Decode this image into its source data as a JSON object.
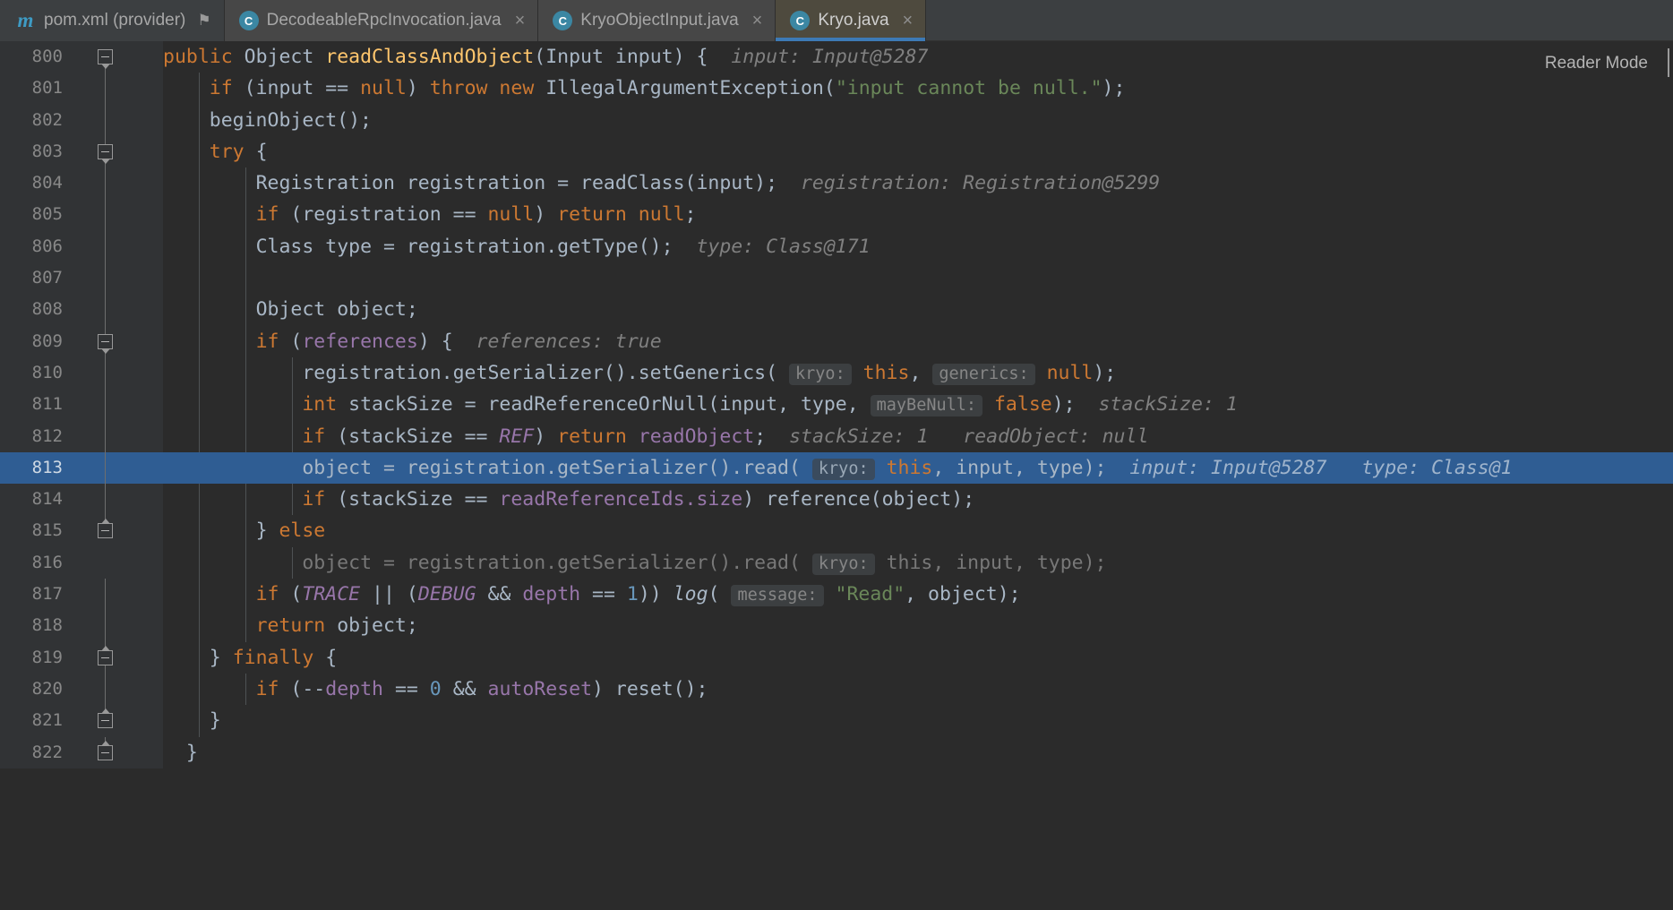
{
  "tabs": [
    {
      "label": "pom.xml (provider)",
      "icon": "maven-icon",
      "icon_text": "m",
      "state": "pinned",
      "pin": "⚑",
      "close": ""
    },
    {
      "label": "DecodeableRpcInvocation.java",
      "icon": "java-class-icon",
      "icon_text": "C",
      "state": "inactive",
      "close": "×"
    },
    {
      "label": "KryoObjectInput.java",
      "icon": "java-class-icon",
      "icon_text": "C",
      "state": "inactive",
      "close": "×"
    },
    {
      "label": "Kryo.java",
      "icon": "java-class-icon",
      "icon_text": "C",
      "state": "active",
      "close": "×"
    }
  ],
  "editor": {
    "reader_mode_label": "Reader Mode",
    "highlighted_line": 813,
    "first_line": 800,
    "last_line": 822,
    "colors": {
      "background": "#2b2b2b",
      "gutter_background": "#313335",
      "line_highlight": "#2f5d93",
      "keyword": "#cc7832",
      "method": "#ffc66d",
      "field": "#9876aa",
      "string": "#6a8759",
      "number": "#6897bb",
      "plain": "#a9b7c6",
      "inline_hint": "#808080",
      "tab_active": "#4e4a3e",
      "tab_underline": "#3d7ab5"
    },
    "lines": [
      {
        "n": "800",
        "text": "    public Object readClassAndObject(Input input) {  input: Input@5287"
      },
      {
        "n": "801",
        "text": "        if (input == null) throw new IllegalArgumentException(\"input cannot be null.\");"
      },
      {
        "n": "802",
        "text": "        beginObject();"
      },
      {
        "n": "803",
        "text": "        try {"
      },
      {
        "n": "804",
        "text": "            Registration registration = readClass(input);  registration: Registration@5299"
      },
      {
        "n": "805",
        "text": "            if (registration == null) return null;"
      },
      {
        "n": "806",
        "text": "            Class type = registration.getType();  type: Class@171"
      },
      {
        "n": "807",
        "text": ""
      },
      {
        "n": "808",
        "text": "            Object object;"
      },
      {
        "n": "809",
        "text": "            if (references) {  references: true"
      },
      {
        "n": "810",
        "text": "                registration.getSerializer().setGenerics( kryo: this,  generics: null);"
      },
      {
        "n": "811",
        "text": "                int stackSize = readReferenceOrNull(input, type,  mayBeNull: false);  stackSize: 1"
      },
      {
        "n": "812",
        "text": "                if (stackSize == REF) return readObject;  stackSize: 1    readObject: null"
      },
      {
        "n": "813",
        "text": "                object = registration.getSerializer().read( kryo: this, input, type);  input: Input@5287    type: Class@1"
      },
      {
        "n": "814",
        "text": "                if (stackSize == readReferenceIds.size) reference(object);"
      },
      {
        "n": "815",
        "text": "            } else"
      },
      {
        "n": "816",
        "text": "                object = registration.getSerializer().read( kryo: this, input, type);"
      },
      {
        "n": "817",
        "text": "            if (TRACE || (DEBUG && depth == 1)) log( message: \"Read\", object);"
      },
      {
        "n": "818",
        "text": "            return object;"
      },
      {
        "n": "819",
        "text": "        } finally {"
      },
      {
        "n": "820",
        "text": "            if (--depth == 0 && autoReset) reset();"
      },
      {
        "n": "821",
        "text": "        }"
      },
      {
        "n": "822",
        "text": "    }"
      }
    ],
    "inline_hints": {
      "line_800": "input: Input@5287",
      "line_804": "registration: Registration@5299",
      "line_806": "type: Class@171",
      "line_809": "references: true",
      "line_811": "stackSize: 1",
      "line_812_a": "stackSize: 1",
      "line_812_b": "readObject: null",
      "line_813_a": "input: Input@5287",
      "line_813_b": "type: Class@1"
    },
    "param_hints": {
      "line_810_a": "kryo:",
      "line_810_b": "generics:",
      "line_811": "mayBeNull:",
      "line_813": "kryo:",
      "line_816": "kryo:",
      "line_817": "message:"
    }
  }
}
